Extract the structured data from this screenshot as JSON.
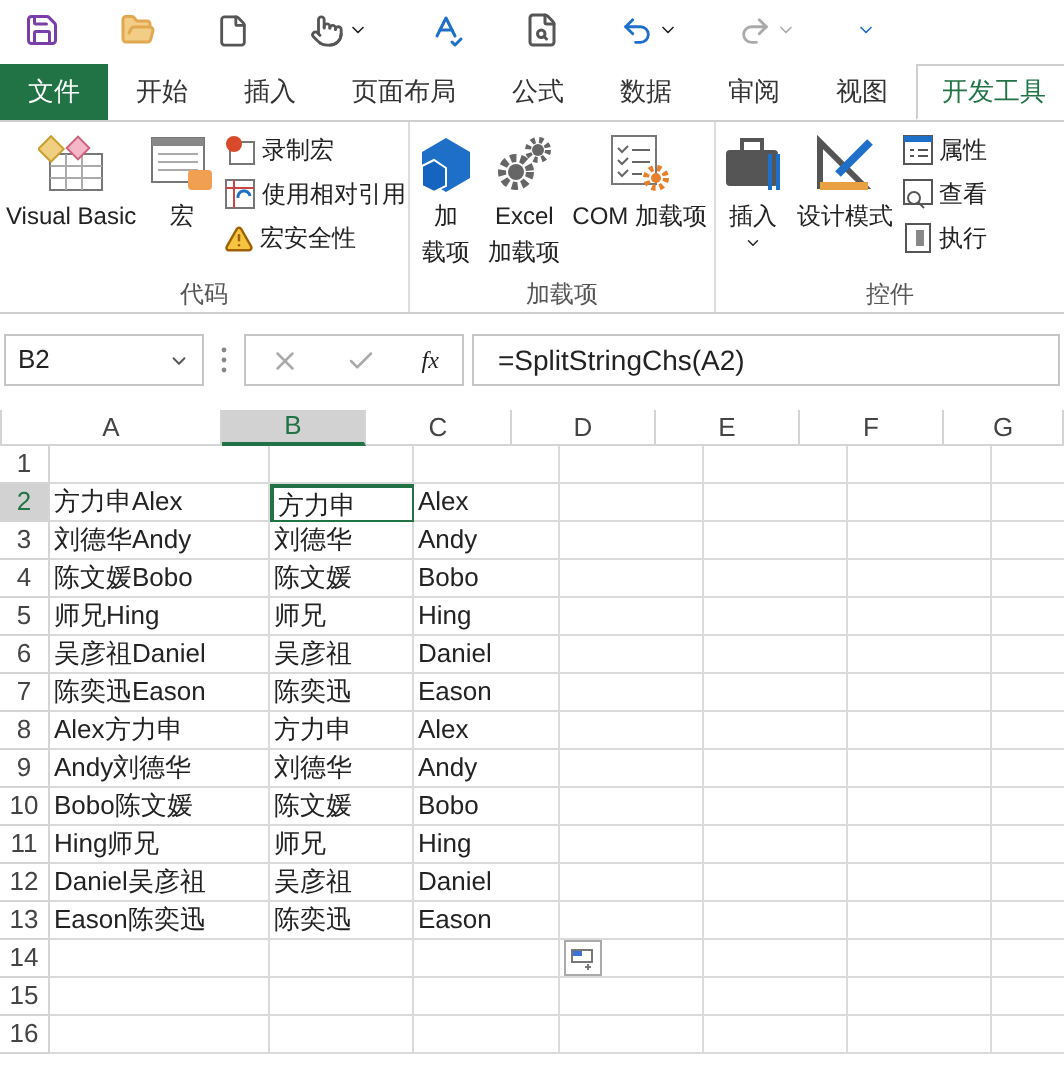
{
  "tabs": [
    {
      "label": "文件",
      "kind": "file",
      "selected": false
    },
    {
      "label": "开始",
      "kind": "tab",
      "selected": false
    },
    {
      "label": "插入",
      "kind": "tab",
      "selected": false
    },
    {
      "label": "页面布局",
      "kind": "tab",
      "selected": false
    },
    {
      "label": "公式",
      "kind": "tab",
      "selected": false
    },
    {
      "label": "数据",
      "kind": "tab",
      "selected": false
    },
    {
      "label": "审阅",
      "kind": "tab",
      "selected": false
    },
    {
      "label": "视图",
      "kind": "tab",
      "selected": false
    },
    {
      "label": "开发工具",
      "kind": "tab",
      "selected": true
    }
  ],
  "ribbon_groups": [
    {
      "label": "代码",
      "items": [
        {
          "kind": "large",
          "lines": [
            "Visual Basic"
          ]
        },
        {
          "kind": "large",
          "lines": [
            "宏"
          ]
        },
        {
          "kind": "small",
          "lines": [
            "录制宏"
          ]
        },
        {
          "kind": "small",
          "lines": [
            "使用相对引用"
          ]
        },
        {
          "kind": "small",
          "lines": [
            "宏安全性"
          ]
        }
      ]
    },
    {
      "label": "加载项",
      "items": [
        {
          "kind": "large",
          "lines": [
            "加",
            "载项"
          ]
        },
        {
          "kind": "large",
          "lines": [
            "Excel",
            "加载项"
          ]
        },
        {
          "kind": "large",
          "lines": [
            "COM 加载项"
          ]
        }
      ]
    },
    {
      "label": "控件",
      "items": [
        {
          "kind": "dropdown",
          "lines": [
            "插入"
          ]
        },
        {
          "kind": "large",
          "lines": [
            "设计模式"
          ]
        },
        {
          "kind": "small",
          "lines": [
            "属性"
          ]
        },
        {
          "kind": "small",
          "lines": [
            "查看"
          ]
        },
        {
          "kind": "small",
          "lines": [
            "执行"
          ]
        }
      ]
    }
  ],
  "name_box": "B2",
  "function_button": "fx",
  "formula": "=SplitStringChs(A2)",
  "columns": [
    {
      "label": "A",
      "selected": false
    },
    {
      "label": "B",
      "selected": true
    },
    {
      "label": "C",
      "selected": false
    },
    {
      "label": "D",
      "selected": false
    },
    {
      "label": "E",
      "selected": false
    },
    {
      "label": "F",
      "selected": false
    },
    {
      "label": "G",
      "selected": false
    }
  ],
  "rows": [
    {
      "header": "1",
      "selected": false,
      "cells": []
    },
    {
      "header": "2",
      "selected": true,
      "cells": [
        "方力申Alex",
        "方力申",
        "Alex"
      ]
    },
    {
      "header": "3",
      "selected": false,
      "cells": [
        "刘德华Andy",
        "刘德华",
        "Andy"
      ]
    },
    {
      "header": "4",
      "selected": false,
      "cells": [
        "陈文媛Bobo",
        "陈文媛",
        "Bobo"
      ]
    },
    {
      "header": "5",
      "selected": false,
      "cells": [
        "师兄Hing",
        "师兄",
        "Hing"
      ]
    },
    {
      "header": "6",
      "selected": false,
      "cells": [
        "吴彦祖Daniel",
        "吴彦祖",
        "Daniel"
      ]
    },
    {
      "header": "7",
      "selected": false,
      "cells": [
        "陈奕迅Eason",
        "陈奕迅",
        "Eason"
      ]
    },
    {
      "header": "8",
      "selected": false,
      "cells": [
        "Alex方力申",
        "方力申",
        "Alex"
      ]
    },
    {
      "header": "9",
      "selected": false,
      "cells": [
        "Andy刘德华",
        "刘德华",
        "Andy"
      ]
    },
    {
      "header": "10",
      "selected": false,
      "cells": [
        "Bobo陈文媛",
        "陈文媛",
        "Bobo"
      ]
    },
    {
      "header": "11",
      "selected": false,
      "cells": [
        "Hing师兄",
        "师兄",
        "Hing"
      ]
    },
    {
      "header": "12",
      "selected": false,
      "cells": [
        "Daniel吴彦祖",
        "吴彦祖",
        "Daniel"
      ]
    },
    {
      "header": "13",
      "selected": false,
      "cells": [
        "Eason陈奕迅",
        "陈奕迅",
        "Eason"
      ]
    },
    {
      "header": "14",
      "selected": false,
      "cells": []
    },
    {
      "header": "15",
      "selected": false,
      "cells": []
    },
    {
      "header": "16",
      "selected": false,
      "cells": []
    }
  ]
}
